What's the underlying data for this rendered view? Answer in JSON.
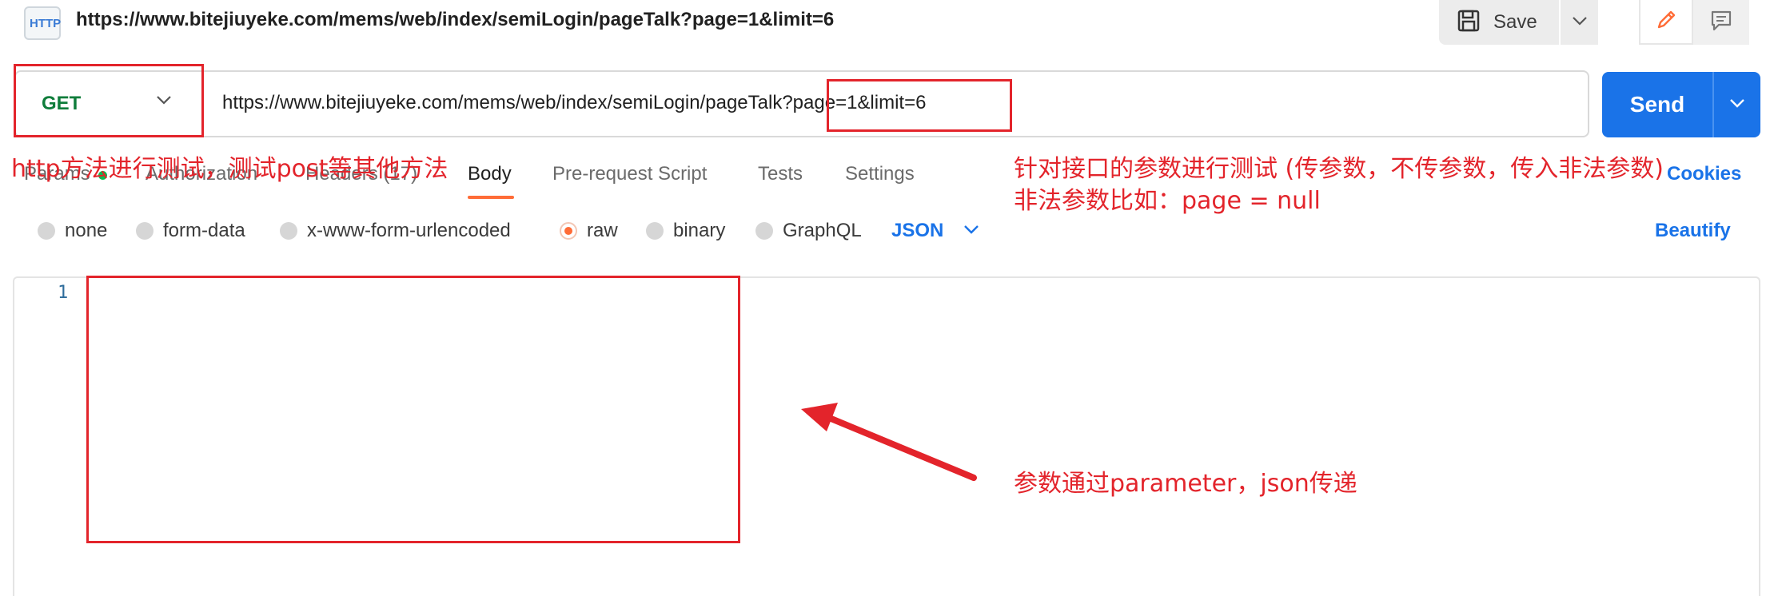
{
  "topbar": {
    "icon_text": "HTTP",
    "url": "https://www.bitejiuyeke.com/mems/web/index/semiLogin/pageTalk?page=1&limit=6",
    "save_label": "Save"
  },
  "request": {
    "method": "GET",
    "url": "https://www.bitejiuyeke.com/mems/web/index/semiLogin/pageTalk?page=1&limit=6",
    "send_label": "Send"
  },
  "tabs": [
    {
      "label": "Params"
    },
    {
      "label": "Authorization"
    },
    {
      "label": "Headers (17)"
    },
    {
      "label": "Body",
      "active": true
    },
    {
      "label": "Pre-request Script"
    },
    {
      "label": "Tests"
    },
    {
      "label": "Settings"
    }
  ],
  "cookies_label": "Cookies",
  "body_options": [
    {
      "label": "none"
    },
    {
      "label": "form-data"
    },
    {
      "label": "x-www-form-urlencoded"
    },
    {
      "label": "raw",
      "selected": true
    },
    {
      "label": "binary"
    },
    {
      "label": "GraphQL"
    }
  ],
  "format_label": "JSON",
  "beautify_label": "Beautify",
  "editor": {
    "line_number": "1"
  },
  "annotations": {
    "method_note": "http方法进行测试，测试post等其他方法",
    "params_note_1": "针对接口的参数进行测试 (传参数，不传参数，传入非法参数)",
    "params_note_2": "非法参数比如：page = null",
    "body_note": "参数通过parameter，json传递"
  },
  "colors": {
    "accent": "#1a73e8",
    "method_get": "#0f7d3b",
    "active_tab": "#ff6c37",
    "annotation": "#e3242b"
  }
}
